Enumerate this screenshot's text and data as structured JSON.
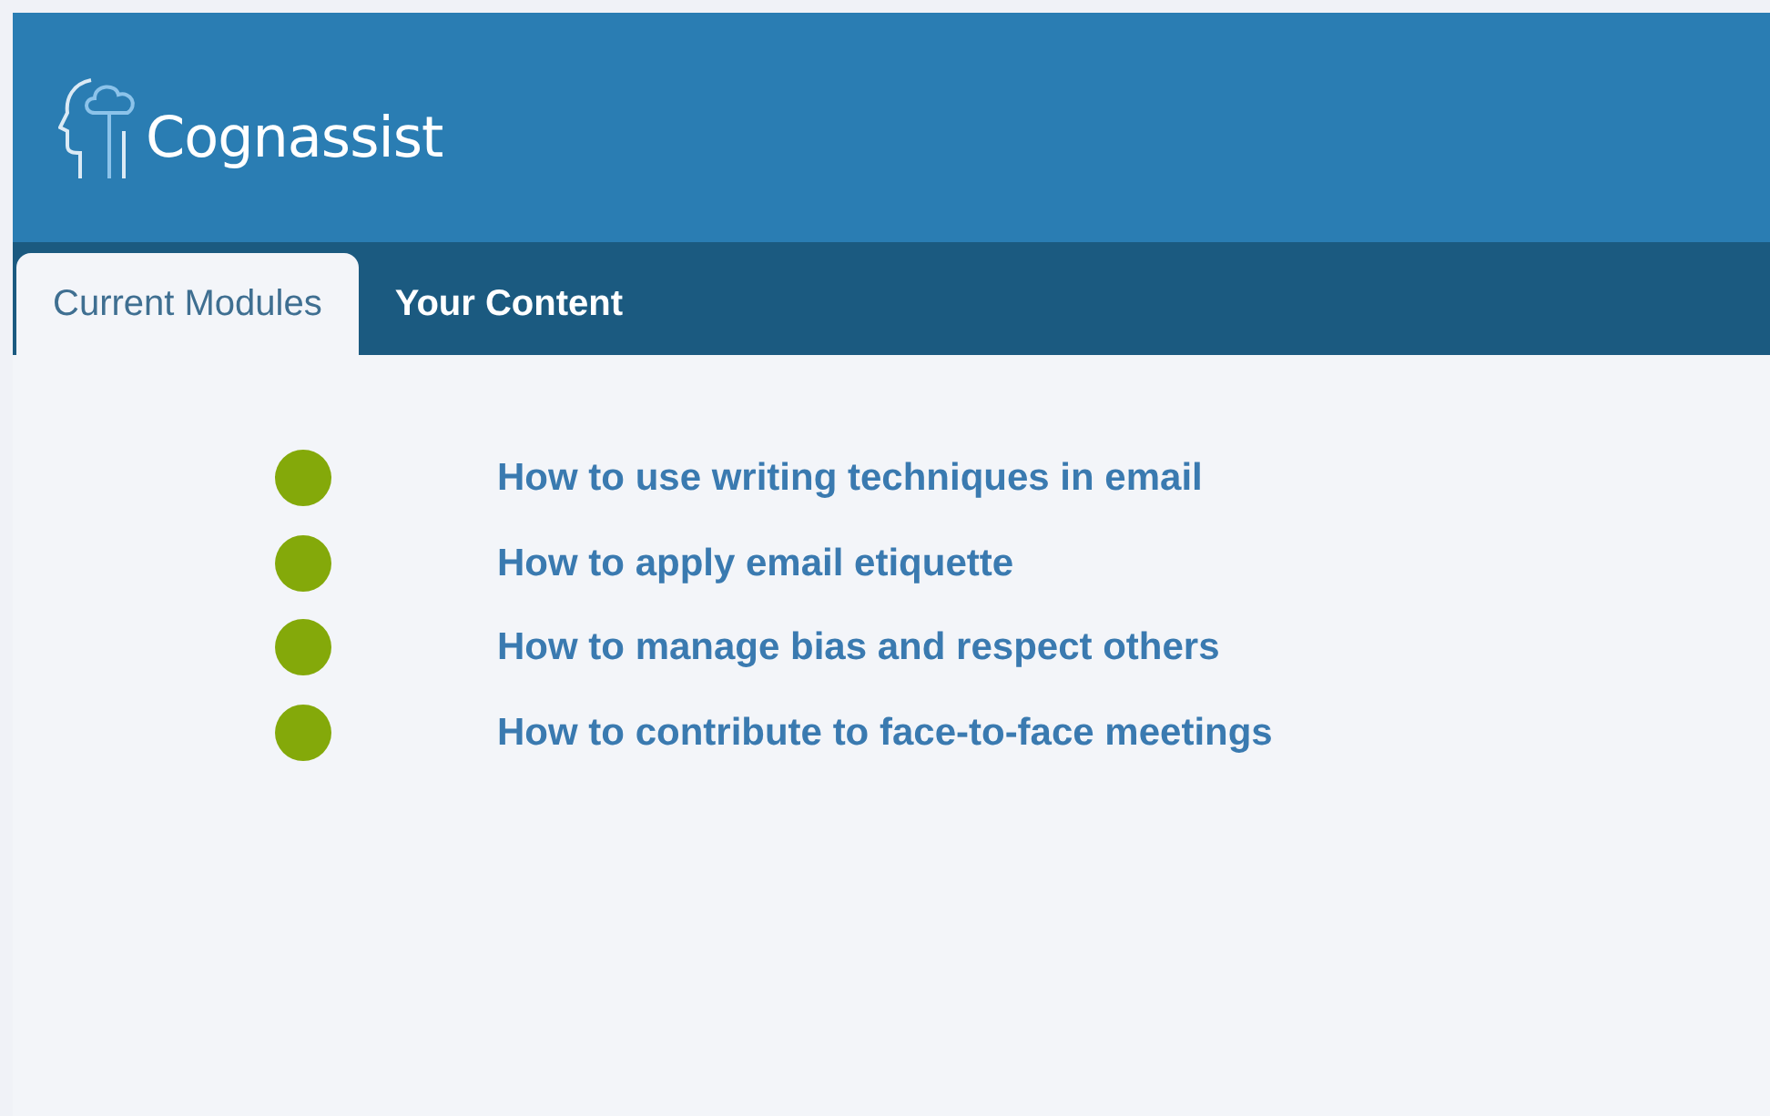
{
  "brand": {
    "name": "Cognassist"
  },
  "tabs": [
    {
      "label": "Current Modules",
      "selected": true
    },
    {
      "label": "Your Content",
      "selected": false
    }
  ],
  "modules": [
    {
      "title": "How to use writing techniques in email",
      "color": "#84a90a"
    },
    {
      "title": "How to apply email etiquette",
      "color": "#84a90a"
    },
    {
      "title": "How to manage bias and respect others",
      "color": "#84a90a"
    },
    {
      "title": "How to contribute to face-to-face meetings",
      "color": "#84a90a"
    }
  ]
}
